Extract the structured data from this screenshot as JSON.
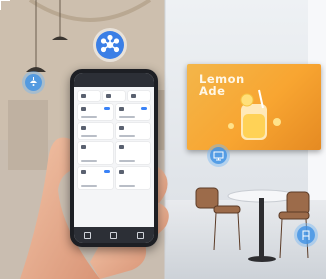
{
  "tv": {
    "title": "Lemon\nAde"
  },
  "icons": {
    "hub": "device-network-icon",
    "pendant": "lamp-icon",
    "display": "screen-icon",
    "chair": "chair-icon"
  },
  "colors": {
    "accent": "#3b7fe6",
    "tv_orange": "#f8a531"
  }
}
